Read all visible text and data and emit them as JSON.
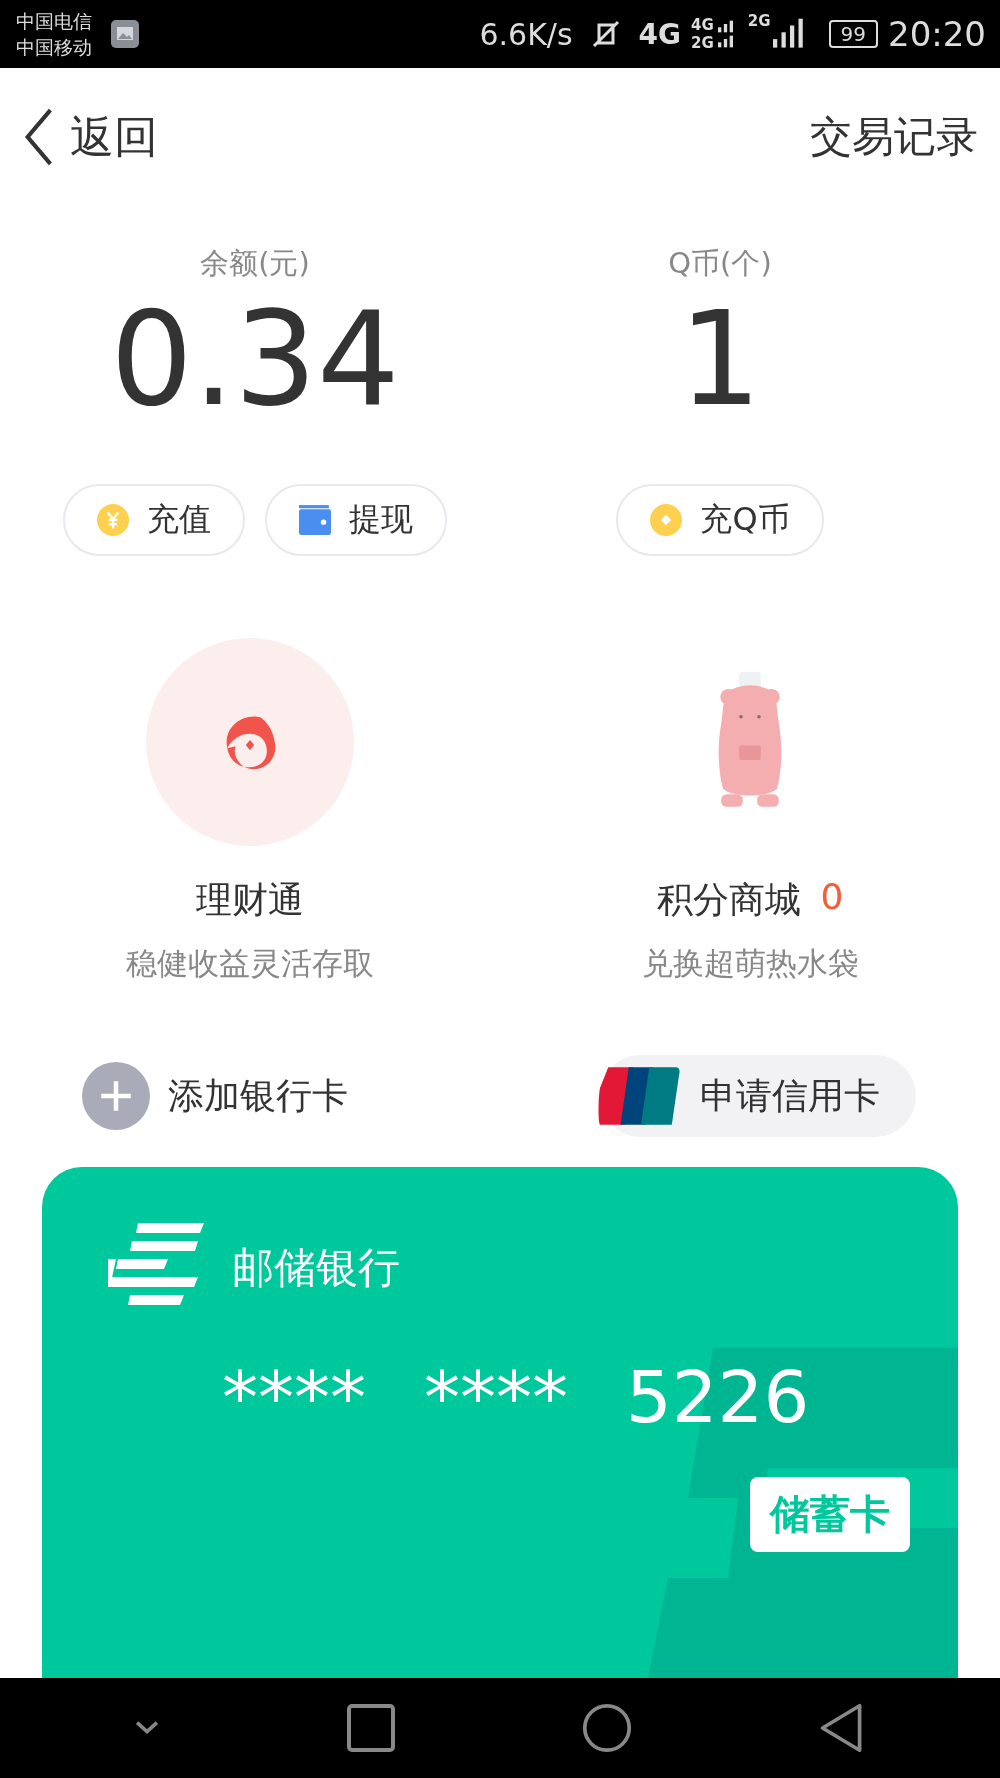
{
  "status_bar": {
    "carriers": [
      "中国电信",
      "中国移动"
    ],
    "speed": "6.6K/s",
    "network": "4G",
    "sim2_networks": [
      "4G",
      "2G"
    ],
    "sim3_network": "2G",
    "battery": "99",
    "time": "20:20"
  },
  "header": {
    "back_label": "返回",
    "action": "交易记录"
  },
  "balances": [
    {
      "label": "余额(元)",
      "value": "0.34"
    },
    {
      "label": "Q币(个)",
      "value": "1"
    }
  ],
  "actions": [
    {
      "kind": "coin",
      "label": "充值"
    },
    {
      "kind": "wallet",
      "label": "提现"
    },
    {
      "kind": "qcoin",
      "label": "充Q币"
    }
  ],
  "features": [
    {
      "kind": "icon",
      "title": "理财通",
      "subtitle": "稳健收益灵活存取"
    },
    {
      "kind": "picture",
      "title": "积分商城",
      "count": "0",
      "subtitle": "兑换超萌热水袋"
    }
  ],
  "bank_actions": [
    {
      "kind": "add",
      "label": "添加银行卡"
    },
    {
      "kind": "credit",
      "label": "申请信用卡"
    }
  ],
  "card": {
    "bank": "邮储银行",
    "number_parts": [
      "****",
      "****",
      "5226"
    ],
    "type": "储蓄卡"
  }
}
